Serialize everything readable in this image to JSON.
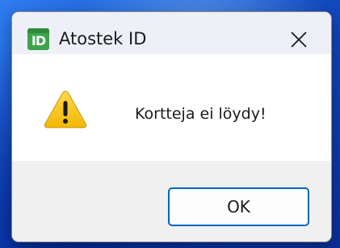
{
  "window": {
    "title": "Atostek ID",
    "app_icon": {
      "name": "atostek-id-logo",
      "text": "ID",
      "color": "#3ea34a"
    },
    "close_icon": "close-icon"
  },
  "message": {
    "icon": "warning-icon",
    "text": "Kortteja ei löydy!"
  },
  "buttons": {
    "ok_label": "OK"
  },
  "colors": {
    "accent": "#0067c0",
    "warning": "#f7c21b",
    "titlebar": "#eef0f7",
    "footer": "#f0f0f0"
  }
}
